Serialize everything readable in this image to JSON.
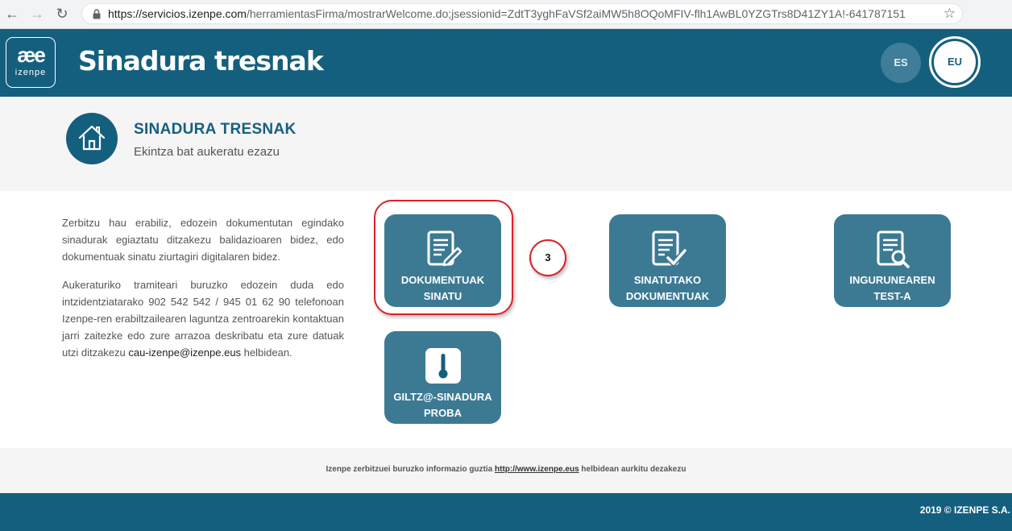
{
  "browser": {
    "url_scheme": "https://",
    "url_host": "servicios.izenpe.com",
    "url_rest": "/herramientasFirma/mostrarWelcome.do;jsessionid=ZdtT3yghFaVSf2aiMW5h8OQoMFIV-flh1AwBL0YZGTrs8D41ZY1A!-641787151"
  },
  "header": {
    "logo_glyph": "æe",
    "logo_text": "izenpe",
    "title": "Sinadura tresnak",
    "lang_es": "ES",
    "lang_eu": "EU"
  },
  "section": {
    "title": "SINADURA TRESNAK",
    "subtitle": "Ekintza bat aukeratu ezazu"
  },
  "description": {
    "paragraph1": "Zerbitzu hau erabiliz, edozein dokumentutan egindako sinadurak egiaztatu ditzakezu balidazioaren bidez, edo dokumentuak sinatu ziurtagiri digitalaren bidez.",
    "paragraph2_a": "Aukeraturiko tramiteari buruzko edozein duda edo intzidentziatarako 902 542 542 / 945 01 62 90 telefonoan Izenpe-ren erabiltzailearen laguntza zentroarekin kontaktuan jarri zaitezke edo zure arrazoa deskribatu eta zure datuak utzi ditzakezu ",
    "paragraph2_email": "cau-izenpe@izenpe.eus",
    "paragraph2_b": " helbidean."
  },
  "tiles": {
    "sign": {
      "line1": "DOKUMENTUAK",
      "line2": "SINATU",
      "icon": "document-pen-icon"
    },
    "signed": {
      "line1": "SINATUTAKO",
      "line2": "DOKUMENTUAK",
      "icon": "document-check-icon"
    },
    "test": {
      "line1": "INGURUNEAREN",
      "line2": "TEST-A",
      "icon": "document-search-icon"
    },
    "giltza": {
      "line1": "GILTZ@-SINADURA",
      "line2": "PROBA",
      "icon": "thermometer-icon"
    }
  },
  "annotation": {
    "step_number": "3"
  },
  "footer": {
    "text_before": "Izenpe zerbitzuei buruzko informazio guztia ",
    "link": "http://www.izenpe.eus",
    "text_after": " helbidean aurkitu dezakezu",
    "copyright": "2019 © IZENPE S.A."
  },
  "colors": {
    "brand": "#155f7e",
    "tile": "#3c7a94",
    "annotation": "#d92229"
  }
}
